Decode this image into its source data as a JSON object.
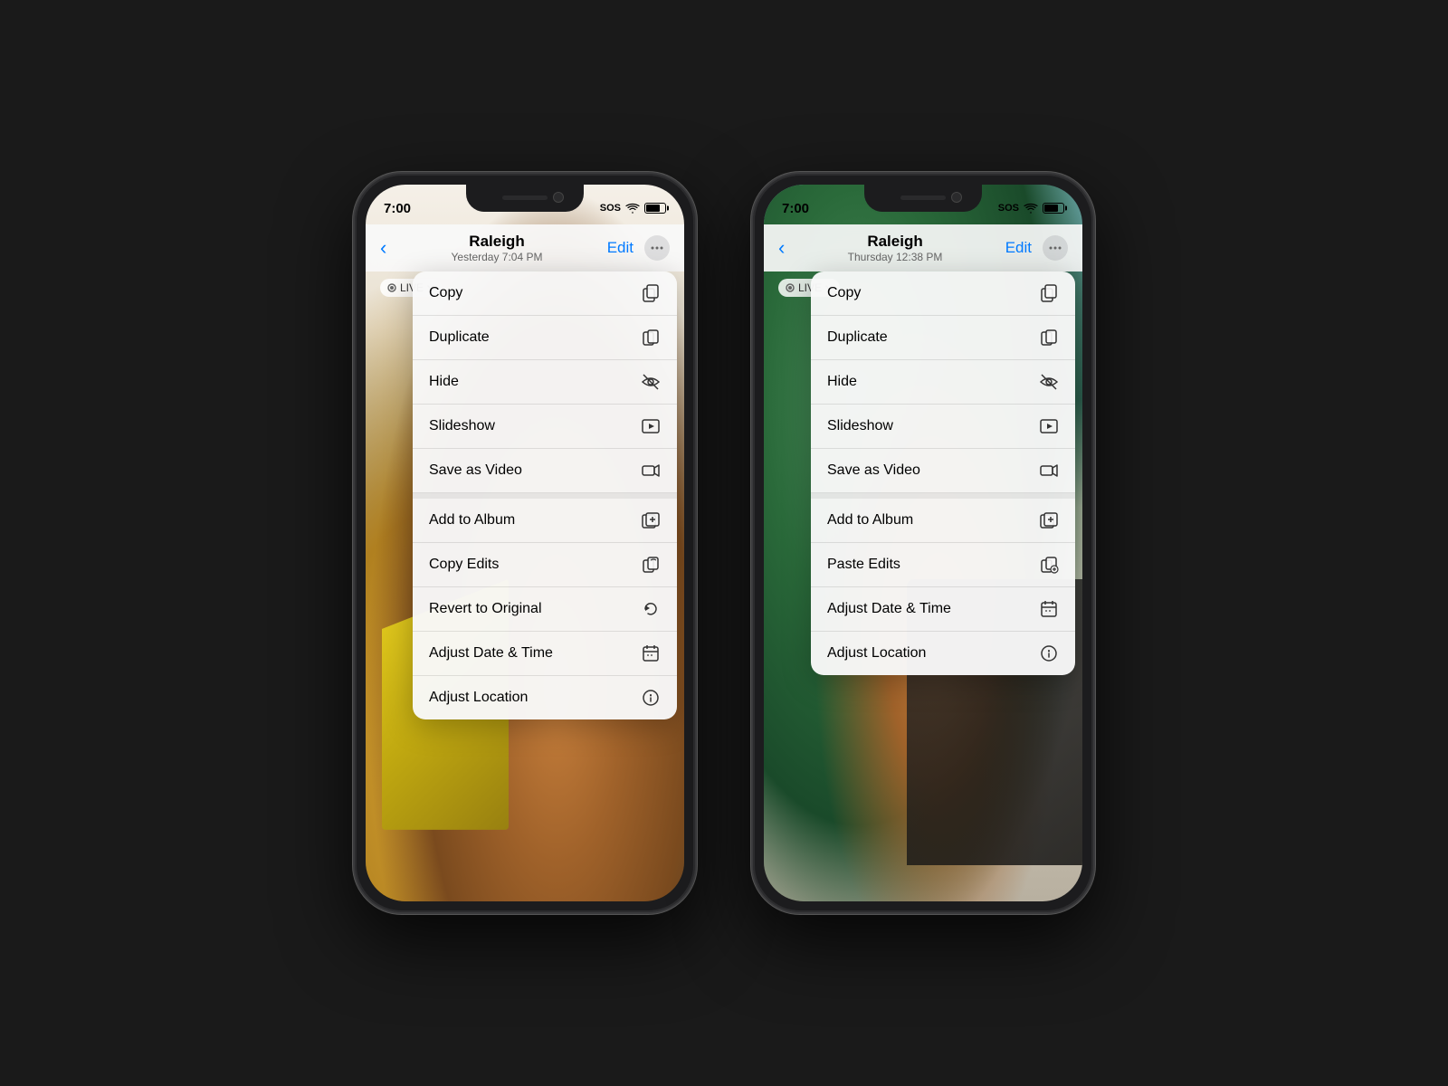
{
  "phones": [
    {
      "id": "phone-left",
      "status": {
        "time": "7:00",
        "sos": "SOS",
        "signal_bars": [
          3,
          5,
          7,
          9,
          11
        ]
      },
      "nav": {
        "title": "Raleigh",
        "subtitle": "Yesterday  7:04 PM",
        "edit_label": "Edit",
        "back_label": "‹"
      },
      "live_label": "LIVE",
      "menu_items": [
        {
          "label": "Copy",
          "icon": "⬜",
          "icon_type": "copy"
        },
        {
          "label": "Duplicate",
          "icon": "⊞",
          "icon_type": "duplicate"
        },
        {
          "label": "Hide",
          "icon": "👁",
          "icon_type": "hide"
        },
        {
          "label": "Slideshow",
          "icon": "▶",
          "icon_type": "slideshow"
        },
        {
          "label": "Save as Video",
          "icon": "🎬",
          "icon_type": "video"
        },
        {
          "label": "Add to Album",
          "icon": "🗂",
          "icon_type": "add-album",
          "section_start": true
        },
        {
          "label": "Copy Edits",
          "icon": "🔁",
          "icon_type": "copy-edits"
        },
        {
          "label": "Revert to Original",
          "icon": "↺",
          "icon_type": "revert"
        },
        {
          "label": "Adjust Date & Time",
          "icon": "📅",
          "icon_type": "date-time"
        },
        {
          "label": "Adjust Location",
          "icon": "ℹ",
          "icon_type": "location"
        }
      ]
    },
    {
      "id": "phone-right",
      "status": {
        "time": "7:00",
        "sos": "SOS",
        "signal_bars": [
          3,
          5,
          7,
          9,
          11
        ]
      },
      "nav": {
        "title": "Raleigh",
        "subtitle": "Thursday  12:38 PM",
        "edit_label": "Edit",
        "back_label": "‹"
      },
      "live_label": "LIVE",
      "menu_items": [
        {
          "label": "Copy",
          "icon": "⬜",
          "icon_type": "copy"
        },
        {
          "label": "Duplicate",
          "icon": "⊞",
          "icon_type": "duplicate"
        },
        {
          "label": "Hide",
          "icon": "👁",
          "icon_type": "hide"
        },
        {
          "label": "Slideshow",
          "icon": "▶",
          "icon_type": "slideshow"
        },
        {
          "label": "Save as Video",
          "icon": "🎬",
          "icon_type": "video"
        },
        {
          "label": "Add to Album",
          "icon": "🗂",
          "icon_type": "add-album",
          "section_start": true
        },
        {
          "label": "Paste Edits",
          "icon": "📋",
          "icon_type": "paste-edits"
        },
        {
          "label": "Adjust Date & Time",
          "icon": "📅",
          "icon_type": "date-time"
        },
        {
          "label": "Adjust Location",
          "icon": "ℹ",
          "icon_type": "location"
        }
      ]
    }
  ],
  "icons": {
    "copy": "⎘",
    "duplicate": "⧉",
    "hide": "◎",
    "slideshow": "▶",
    "video": "⬛",
    "add-album": "⊞",
    "copy-edits": "⎘",
    "paste-edits": "⎙",
    "revert": "↺",
    "date-time": "⊞",
    "location": "ⓘ",
    "more": "•••",
    "back": "‹",
    "live-circle": "◎",
    "chevron-down": "˅"
  }
}
